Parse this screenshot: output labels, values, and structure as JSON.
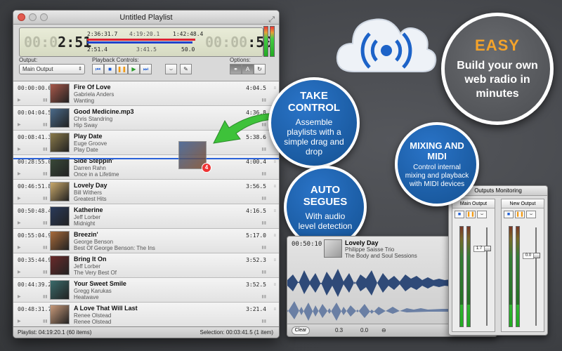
{
  "window": {
    "title": "Untitled Playlist"
  },
  "lcd": {
    "left_dim": "00:0",
    "left_time": "2:51",
    "top_elapsed": "2:36:31.7",
    "top_total": "4:19:20.1",
    "top_remaining": "1:42:48.4",
    "bottom_elapsed": "2:51.4",
    "bottom_total": "3:41.5",
    "bottom_remaining": "50.0",
    "right_dim": "00:00",
    "right_time": ":50",
    "bar_progress": 0.6
  },
  "controls": {
    "output_label": "Output:",
    "output_value": "Main Output",
    "playback_label": "Playback Controls:",
    "options_label": "Options:",
    "opt_a": "A"
  },
  "tracks": [
    {
      "time": "00:00:00.0",
      "title": "Fire Of Love",
      "artist": "Gabriela Anders",
      "album": "Wanting",
      "dur": "4:04.5",
      "cover": "#a8584a"
    },
    {
      "time": "00:04:04.5",
      "title": "Good Medicine.mp3",
      "artist": "Chris Standring",
      "album": "Hip Sway",
      "dur": "4:36.8",
      "cover": "#4a6a8a"
    },
    {
      "time": "00:08:41.3",
      "title": "Play Date",
      "artist": "Euge Groove",
      "album": "Play Date",
      "dur": "5:38.6",
      "cover": "#8a7a4a"
    },
    {
      "time": "00:28:55.0",
      "title": "Side Steppin'",
      "artist": "Darren Rahn",
      "album": "Once in a Lifetime",
      "dur": "4:00.4",
      "cover": "#3a4a3a"
    },
    {
      "time": "00:46:51.8",
      "title": "Lovely Day",
      "artist": "Bill Withers",
      "album": "Greatest Hits",
      "dur": "3:56.5",
      "cover": "#c8a86a"
    },
    {
      "time": "00:50:48.4",
      "title": "Katherine",
      "artist": "Jeff Lorber",
      "album": "Midnight",
      "dur": "4:16.5",
      "cover": "#2a3a5a"
    },
    {
      "time": "00:55:04.9",
      "title": "Breezin'",
      "artist": "George Benson",
      "album": "Best Of George Benson: The Ins",
      "dur": "5:17.0",
      "cover": "#a86a3a"
    },
    {
      "time": "00:35:44.9",
      "title": "Bring It On",
      "artist": "Jeff Lorber",
      "album": "The Very Best Of",
      "dur": "3:52.3",
      "cover": "#6a2a2a"
    },
    {
      "time": "00:44:39.2",
      "title": "Your Sweet Smile",
      "artist": "Gregg Karukas",
      "album": "Heatwave",
      "dur": "3:52.5",
      "cover": "#3a6a6a"
    },
    {
      "time": "00:48:31.7",
      "title": "A Love That Will Last",
      "artist": "Renee Olstead",
      "album": "Renee Olstead",
      "dur": "3:21.4",
      "cover": "#c89a7a"
    }
  ],
  "status": {
    "left": "Playlist: 04:19:20.1 (60 items)",
    "right": "Selection: 00:03:41.5 (1 item)"
  },
  "drag": {
    "badge": "4"
  },
  "callouts": {
    "take_control": {
      "heading": "TAKE CONTROL",
      "body": "Assemble playlists with a simple drag and drop"
    },
    "auto_segues": {
      "heading": "AUTO SEGUES",
      "body": "With audio level detection"
    },
    "mixing": {
      "heading": "MIXING AND MIDI",
      "body": "Control internal mixing and playback with MIDI devices"
    },
    "easy": {
      "heading": "EASY",
      "body": "Build your own web radio in minutes"
    }
  },
  "wave_panel": {
    "time": "00:50:10",
    "title": "Lovely Day",
    "artist": "Philippe Saisse Trio",
    "album": "The Body and Soul Sessions",
    "clear_label": "Clear",
    "val1": "0.3",
    "val2": "0.0"
  },
  "outputs_panel": {
    "title": "Outputs Monitoring",
    "ch1": {
      "name": "Main Output",
      "fader_value": "1.7"
    },
    "ch2": {
      "name": "New Output",
      "fader_value": "0.0"
    }
  }
}
